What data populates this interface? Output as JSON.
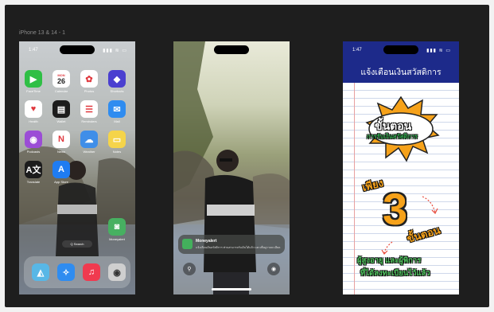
{
  "frame_label": "iPhone 13 & 14 - 1",
  "home": {
    "time": "1:47",
    "signal": "▮▮▮ ≋ ▭",
    "apps": [
      {
        "name": "FaceTime",
        "glyph": "▶",
        "color": "#2fbf45"
      },
      {
        "name": "Calendar",
        "glyph": "26",
        "color": "#ffffff",
        "sub": "MON"
      },
      {
        "name": "Photos",
        "glyph": "✿",
        "color": "#ffffff"
      },
      {
        "name": "Shortcuts",
        "glyph": "◆",
        "color": "#4a3fd0"
      },
      {
        "name": "Health",
        "glyph": "♥",
        "color": "#ffffff"
      },
      {
        "name": "Wallet",
        "glyph": "▤",
        "color": "#1c1c1c"
      },
      {
        "name": "Reminders",
        "glyph": "☰",
        "color": "#ffffff"
      },
      {
        "name": "Mail",
        "glyph": "✉",
        "color": "#2f8cf0"
      },
      {
        "name": "Podcasts",
        "glyph": "◉",
        "color": "#9b4dd6"
      },
      {
        "name": "News",
        "glyph": "N",
        "color": "#ffffff"
      },
      {
        "name": "Weather",
        "glyph": "☁",
        "color": "#3f8ee8"
      },
      {
        "name": "Notes",
        "glyph": "▭",
        "color": "#f5d44a"
      },
      {
        "name": "Translate",
        "glyph": "A文",
        "color": "#1c1c1c"
      },
      {
        "name": "App Store",
        "glyph": "A",
        "color": "#1f7cf2"
      },
      {
        "name": "Moneyalert",
        "glyph": "◙",
        "color": "#47b061"
      }
    ],
    "search": "Q Search",
    "dock": [
      {
        "name": "Maps",
        "glyph": "◭",
        "color": "#58b7e6"
      },
      {
        "name": "Safari",
        "glyph": "✧",
        "color": "#2f8cf0"
      },
      {
        "name": "Music",
        "glyph": "♫",
        "color": "#f03a4f"
      },
      {
        "name": "Camera",
        "glyph": "◉",
        "color": "#cfcfcf"
      }
    ]
  },
  "lock": {
    "notif_title": "Moneyalert",
    "notif_body": "แจ้งเตือนเงินสวัสดิการ ท่านสามารถรับเงินได้แล้ว แตะเพื่อดูรายละเอียด",
    "flashlight": "⚲",
    "camera": "◉"
  },
  "alert": {
    "time": "1:47",
    "signal": "▮▮▮ ≋ ▭",
    "title": "แจ้งเตือนเงินสวัสดิการ",
    "burst_line1": "ขั้นตอน",
    "burst_line2": "การรับเงินสวัสดิการ",
    "only": "เพียง",
    "number": "3",
    "steps": "ขั้นตอน",
    "footer1": "ผู้สูงอายุ และผู้พิการ",
    "footer2": "ที่ได้ลงทะเบียนไว้แล้ว"
  }
}
